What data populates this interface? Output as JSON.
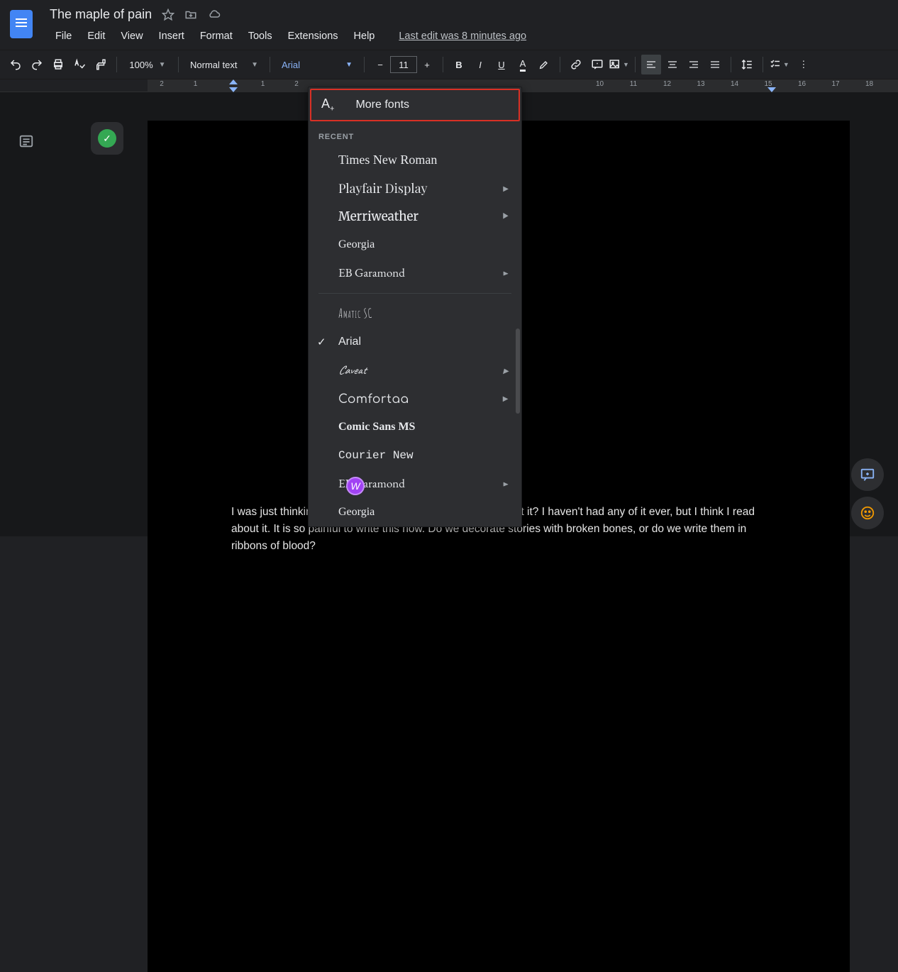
{
  "doc_title": "The maple of pain",
  "menu": {
    "file": "File",
    "edit": "Edit",
    "view": "View",
    "insert": "Insert",
    "format": "Format",
    "tools": "Tools",
    "extensions": "Extensions",
    "help": "Help",
    "last_edit": "Last edit was 8 minutes ago"
  },
  "toolbar": {
    "zoom": "100%",
    "style": "Normal text",
    "font": "Arial",
    "font_size": "11"
  },
  "ruler_ticks": [
    "2",
    "1",
    "",
    "1",
    "2",
    "",
    "",
    "",
    "",
    "",
    "",
    "",
    "",
    "10",
    "11",
    "12",
    "13",
    "14",
    "15",
    "16",
    "17",
    "18"
  ],
  "font_menu": {
    "more_fonts": "More fonts",
    "recent_label": "RECENT",
    "recent": [
      {
        "name": "Times New Roman",
        "cls": "f-times",
        "sub": false
      },
      {
        "name": "Playfair Display",
        "cls": "f-playfair",
        "sub": true
      },
      {
        "name": "Merriweather",
        "cls": "f-merri",
        "sub": true
      },
      {
        "name": "Georgia",
        "cls": "f-georgia",
        "sub": false
      },
      {
        "name": "EB Garamond",
        "cls": "f-ebg",
        "sub": true
      }
    ],
    "all": [
      {
        "name": "Amatic SC",
        "cls": "f-amatic",
        "sub": false,
        "sel": false
      },
      {
        "name": "Arial",
        "cls": "f-arial",
        "sub": false,
        "sel": true
      },
      {
        "name": "Caveat",
        "cls": "f-caveat",
        "sub": true,
        "sel": false
      },
      {
        "name": "Comfortaa",
        "cls": "f-comfortaa",
        "sub": true,
        "sel": false
      },
      {
        "name": "Comic Sans MS",
        "cls": "f-comic",
        "sub": false,
        "sel": false
      },
      {
        "name": "Courier New",
        "cls": "f-courier",
        "sub": false,
        "sel": false
      },
      {
        "name": "EB Garamond",
        "cls": "f-ebg",
        "sub": true,
        "sel": false
      },
      {
        "name": "Georgia",
        "cls": "f-georgia",
        "sub": false,
        "sel": false
      }
    ]
  },
  "collaborator_initial": "W",
  "document_body": "I was just thinking to myself, pain is a story, definitely is, isn't it? I haven't had any of it ever, but I think I read about it. It is so painful to write this now. Do we decorate stories with broken bones, or do we write them in ribbons of blood?"
}
